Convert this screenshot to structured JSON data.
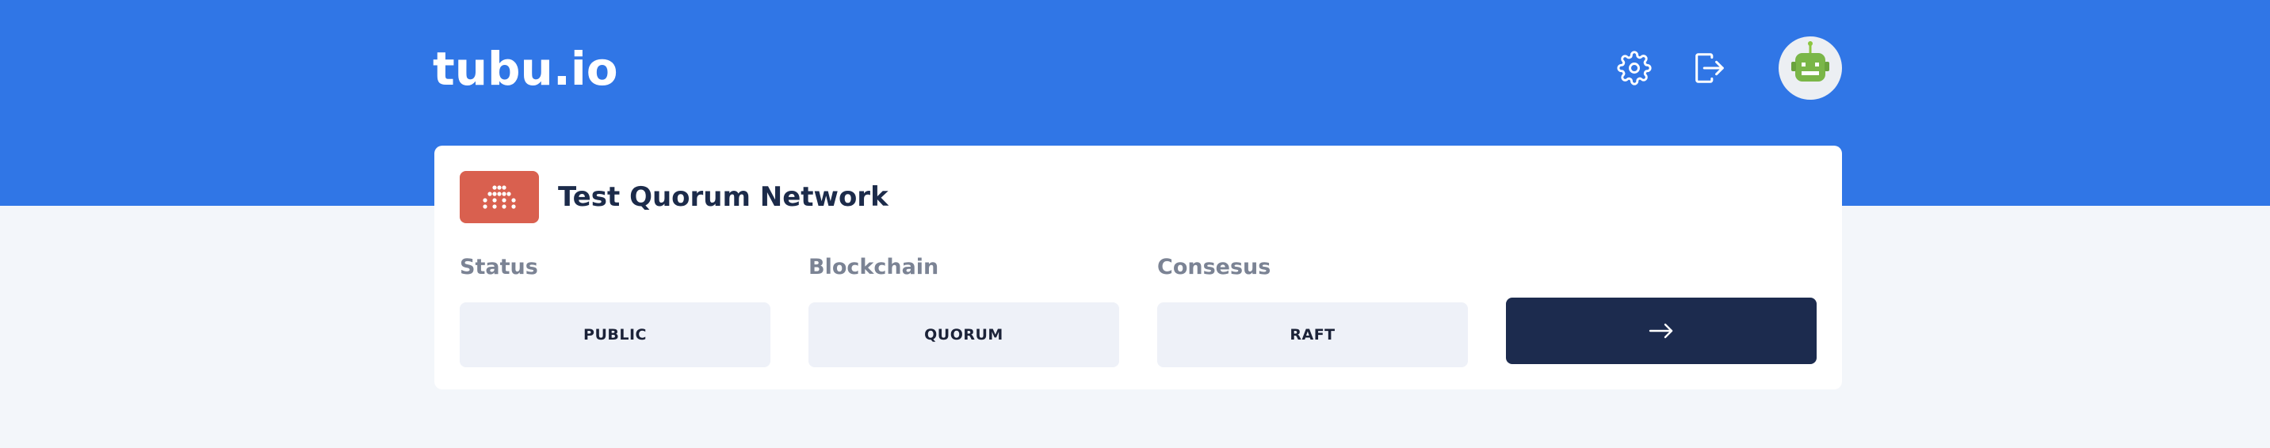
{
  "brand": {
    "logo_text": "tubu.io",
    "primary_color": "#3076e6"
  },
  "header": {
    "actions": [
      {
        "icon": "gear-icon",
        "purpose": "settings"
      },
      {
        "icon": "logout-icon",
        "purpose": "sign out"
      }
    ],
    "avatar": {
      "icon": "robot-avatar-icon"
    }
  },
  "network": {
    "badge_icon": "dots-grid-icon",
    "badge_color": "#d9604f",
    "title": "Test Quorum Network",
    "fields": [
      {
        "label": "Status",
        "value": "PUBLIC"
      },
      {
        "label": "Blockchain",
        "value": "QUORUM"
      },
      {
        "label": "Consesus",
        "value": "RAFT"
      }
    ],
    "open_button": {
      "icon": "arrow-right-icon",
      "color": "#1c2b4e"
    }
  }
}
